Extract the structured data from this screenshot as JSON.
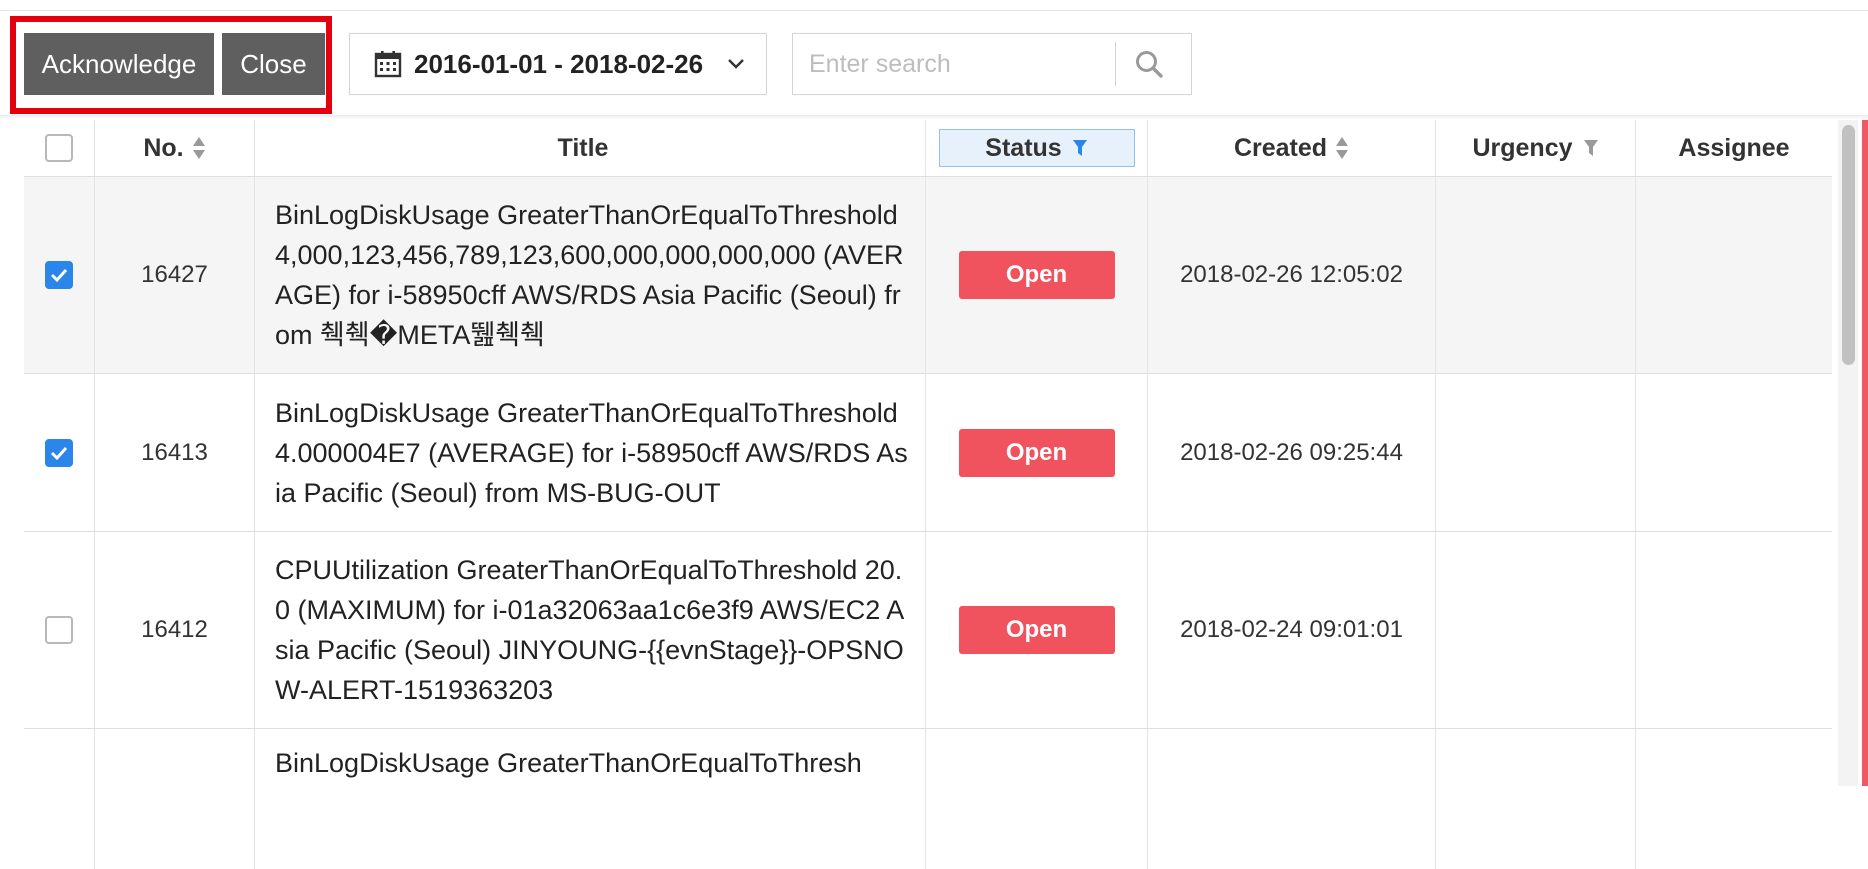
{
  "toolbar": {
    "acknowledge_label": "Acknowledge",
    "close_label": "Close",
    "date_range": "2016-01-01 - 2018-02-26",
    "search_placeholder": "Enter search",
    "search_value": ""
  },
  "table": {
    "columns": {
      "no": "No.",
      "title": "Title",
      "status": "Status",
      "created": "Created",
      "urgency": "Urgency",
      "assignee": "Assignee"
    },
    "rows": [
      {
        "checked": true,
        "no": "16427",
        "title": "BinLogDiskUsage GreaterThanOrEqualToThreshold 4,000,123,456,789,123,600,000,000,000,000 (AVERAGE) for i-58950cff AWS/RDS Asia Pacific (Seoul) from 췍췍�META뛢췍췍",
        "status": "Open",
        "created": "2018-02-26 12:05:02",
        "urgency": "",
        "assignee": ""
      },
      {
        "checked": true,
        "no": "16413",
        "title": "BinLogDiskUsage GreaterThanOrEqualToThreshold 4.000004E7 (AVERAGE) for i-58950cff AWS/RDS Asia Pacific (Seoul) from MS-BUG-OUT",
        "status": "Open",
        "created": "2018-02-26 09:25:44",
        "urgency": "",
        "assignee": ""
      },
      {
        "checked": false,
        "no": "16412",
        "title": "CPUUtilization GreaterThanOrEqualToThreshold 20.0 (MAXIMUM) for i-01a32063aa1c6e3f9 AWS/EC2 Asia Pacific (Seoul) JINYOUNG-{{evnStage}}-OPSNOW-ALERT-1519363203",
        "status": "Open",
        "created": "2018-02-24 09:01:01",
        "urgency": "",
        "assignee": ""
      },
      {
        "checked": false,
        "no": "",
        "title": "BinLogDiskUsage GreaterThanOrEqualToThresh",
        "status": "",
        "created": "",
        "urgency": "",
        "assignee": ""
      }
    ]
  },
  "colors": {
    "highlight_border": "#e4000d",
    "toolbar_button_bg": "#5f5f5f",
    "status_open": "#f0525e",
    "checkbox_checked": "#2a86e8",
    "status_header_filter_bg": "#e7f1fb"
  },
  "icons": {
    "date_picker": "calendar-icon",
    "date_dropdown": "chevron-down-icon",
    "search": "search-icon",
    "sort": "sort-icon",
    "filter": "filter-icon"
  }
}
